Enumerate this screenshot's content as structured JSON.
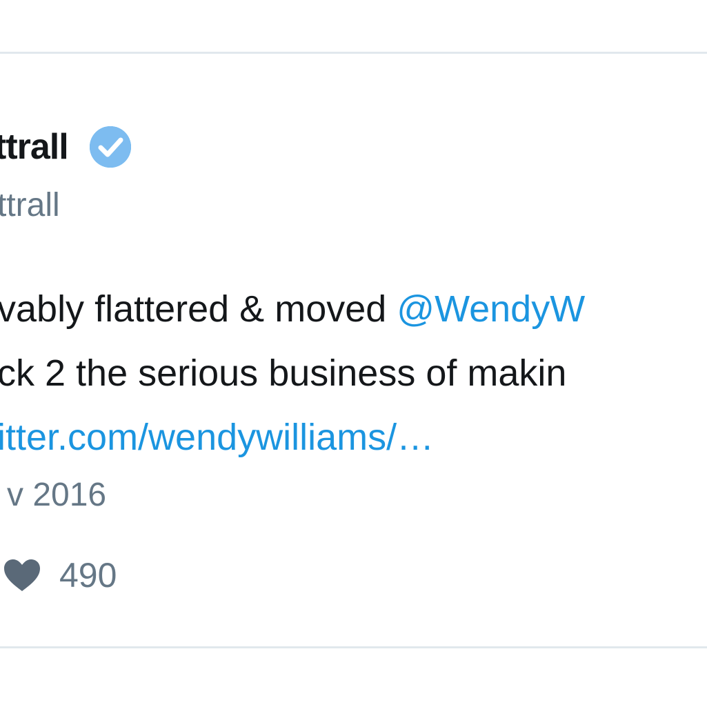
{
  "tweet": {
    "display_name": "ttrall",
    "handle": "ttrall",
    "text_lines": [
      {
        "pre": "vably flattered & moved ",
        "mention": "@WendyW"
      },
      {
        "text": "ck 2 the serious business of makin"
      },
      {
        "link": "itter.com/wendywilliams/…"
      }
    ],
    "timestamp": "v 2016",
    "like_count": "490"
  },
  "icons": {
    "verified": "verified-badge-icon",
    "like": "heart-icon"
  },
  "colors": {
    "verified_blue": "#1da1f2",
    "link_blue": "#1b95e0",
    "text": "#14171a",
    "muted": "#657786",
    "heart": "#5a6978",
    "divider": "#e1e8ed"
  }
}
